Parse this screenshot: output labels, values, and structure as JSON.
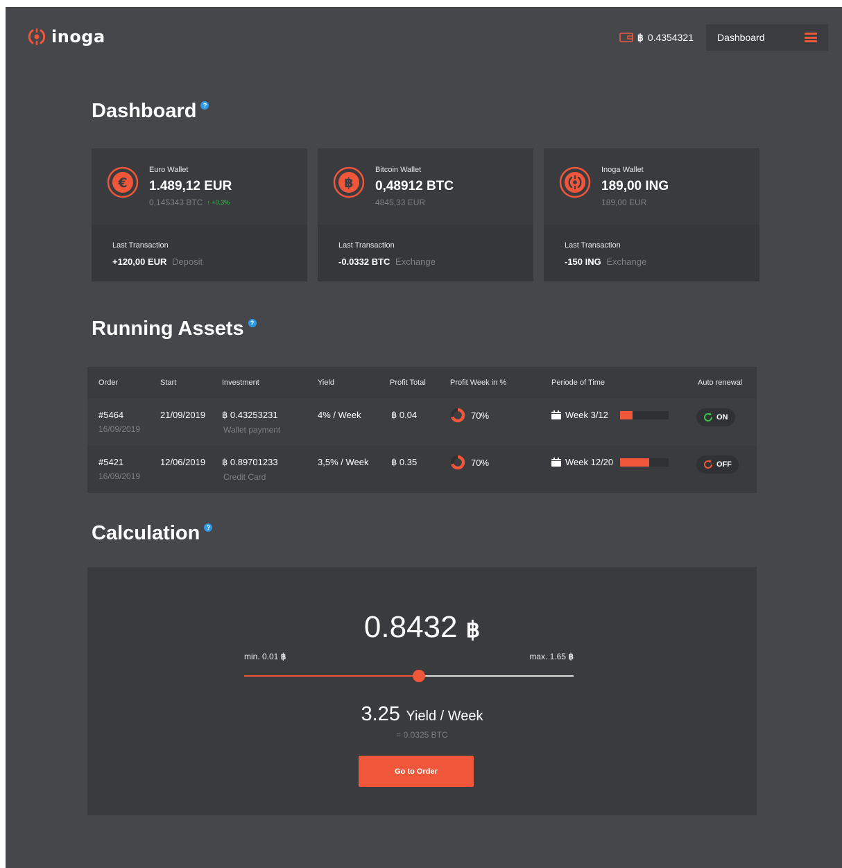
{
  "header": {
    "logo_text": "inoga",
    "balance_symbol": "฿",
    "balance": "0.4354321",
    "dashboard_label": "Dashboard"
  },
  "sections": {
    "dashboard": "Dashboard",
    "running_assets": "Running Assets",
    "calculation": "Calculation",
    "help_glyph": "?"
  },
  "wallets": [
    {
      "icon": "euro-icon",
      "name": "Euro Wallet",
      "amount": "1.489,12 EUR",
      "sub": "0,145343 BTC",
      "change": "↑ +0,3%",
      "last_label": "Last Transaction",
      "last_amount": "+120,00 EUR",
      "last_type": "Deposit"
    },
    {
      "icon": "bitcoin-icon",
      "name": "Bitcoin Wallet",
      "amount": "0,48912 BTC",
      "sub": "4845,33 EUR",
      "change": "",
      "last_label": "Last Transaction",
      "last_amount": "-0.0332 BTC",
      "last_type": "Exchange"
    },
    {
      "icon": "inoga-coin-icon",
      "name": "Inoga Wallet",
      "amount": "189,00 ING",
      "sub": "189,00 EUR",
      "change": "",
      "last_label": "Last Transaction",
      "last_amount": "-150 ING",
      "last_type": "Exchange"
    }
  ],
  "assets": {
    "columns": [
      "Order",
      "Start",
      "Investment",
      "Yield",
      "Profit Total",
      "Profit  Week in %",
      "Periode of Time",
      "Auto renewal"
    ],
    "rows": [
      {
        "order": "#5464",
        "order_date": "16/09/2019",
        "start": "21/09/2019",
        "investment": "฿ 0.43253231",
        "investment_method": "Wallet payment",
        "yield": "4% / Week",
        "profit_total": "฿ 0.04",
        "profit_week": "70%",
        "period": "Week 3/12",
        "period_fraction": 0.25,
        "renewal": "ON",
        "renewal_color": "#3ac24b"
      },
      {
        "order": "#5421",
        "order_date": "16/09/2019",
        "start": "12/06/2019",
        "investment": "฿ 0.89701233",
        "investment_method": "Credit Card",
        "yield": "3,5% / Week",
        "profit_total": "฿ 0.35",
        "profit_week": "70%",
        "period": "Week 12/20",
        "period_fraction": 0.6,
        "renewal": "OFF",
        "renewal_color": "#f0573a"
      }
    ]
  },
  "calculation": {
    "amount": "0.8432",
    "symbol": "฿",
    "min_label": "min. 0.01",
    "max_label": "max. 1.65",
    "slider_fraction": 0.53,
    "yield_value": "3.25",
    "yield_label": "Yield / Week",
    "yield_sub": "= 0.0325 BTC",
    "button_label": "Go to Order"
  },
  "colors": {
    "accent": "#f0573a",
    "positive": "#3ac24b",
    "help": "#2f9be6"
  }
}
